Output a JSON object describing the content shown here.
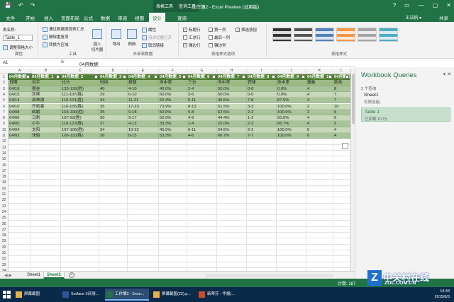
{
  "titlebar": {
    "title": "工作簿2 - Excel Preview (试用版)",
    "context1": "表格工具",
    "context2": "查询工具",
    "quick_access": [
      "💾",
      "↶",
      "↷"
    ],
    "window_controls": [
      "?",
      "▭",
      "—",
      "▢",
      "✕"
    ]
  },
  "tabs": {
    "items": [
      "文件",
      "开始",
      "插入",
      "页面布局",
      "公式",
      "数据",
      "审阅",
      "视图",
      "设计",
      "查询"
    ],
    "active": "设计",
    "user": "王洁帆 ▾",
    "share": "共享"
  },
  "ribbon": {
    "props": {
      "label": "表名称:",
      "table_name": "Table_1",
      "resize": "调整表格大小",
      "group": "属性"
    },
    "tools": {
      "pivot": "通过数据透视表汇总",
      "dedupe": "删除重复项",
      "convert": "转换为区域",
      "slicer": "插入\n切片器",
      "group": "工具"
    },
    "external": {
      "export": "导出",
      "refresh": "刷新",
      "properties": "属性",
      "open_browser": "用浏览器打开",
      "unlink": "取消链接",
      "group": "外部表数据"
    },
    "style_options": {
      "header_row": "标题行",
      "total_row": "汇总行",
      "banded_rows": "镶边行",
      "first_col": "第一列",
      "last_col": "最后一列",
      "banded_cols": "镶边列",
      "filter_btn": "筛选按钮",
      "group": "表格样式选项"
    },
    "styles": {
      "group": "表格样式"
    }
  },
  "formula_bar": {
    "ref": "A1",
    "fx": "fx",
    "value": "04月数据"
  },
  "columns": [
    "A",
    "B",
    "C",
    "D",
    "E",
    "F",
    "G",
    "H",
    "I",
    "J",
    "K",
    "L"
  ],
  "grid": {
    "header_row": [
      "04月数据",
      "04月数据_1",
      "04月数据_2",
      "04月数据_3",
      "04月数据_4",
      "04月数据_5",
      "04月数据_6",
      "04月数据_7",
      "04月数据_8",
      "04月数据_9",
      "04月数据_10",
      "04月数据_"
    ],
    "sub_header": [
      "日期",
      "对手",
      "比分",
      "时间",
      "投篮",
      "命中率",
      "三分",
      "命中率",
      "罚球",
      "命中率",
      "篮板",
      "助攻"
    ],
    "rows": [
      [
        "04/16",
        "掘金",
        "133-126(胜)",
        "40",
        "4-10",
        "40.0%",
        "2-4",
        "50.0%",
        "0-0",
        "0.0%",
        "4",
        "8"
      ],
      [
        "04/15",
        "灰熊",
        "111-107(胜)",
        "29",
        "6-10",
        "60.0%",
        "3-6",
        "50.0%",
        "0-0",
        "0.0%",
        "4",
        "7"
      ],
      [
        "04/14",
        "森林狼",
        "110-101(胜)",
        "34",
        "11-21",
        "52.4%",
        "5-11",
        "45.5%",
        "7-8",
        "87.5%",
        "4",
        "7"
      ],
      [
        "04/10",
        "开拓者",
        "116-105(胜)",
        "35",
        "17-23",
        "73.9%",
        "8-13",
        "61.5%",
        "3-3",
        "100.0%",
        "2",
        "10"
      ],
      [
        "04/08",
        "鹈鹕",
        "103-100(胜)",
        "35",
        "9-18",
        "50.0%",
        "5-8",
        "62.5%",
        "2-2",
        "100.0%",
        "2",
        "9"
      ],
      [
        "04/06",
        "马刺",
        "107-92(胜)",
        "30",
        "9-17",
        "52.9%",
        "4-9",
        "44.4%",
        "1-2",
        "50.0%",
        "4",
        "6"
      ],
      [
        "04/05",
        "小牛",
        "110-123(胜)",
        "27",
        "4-12",
        "33.3%",
        "1-4",
        "25.0%",
        "2-3",
        "66.7%",
        "4",
        "3"
      ],
      [
        "04/04",
        "太阳",
        "107-106(胜)",
        "34",
        "10-22",
        "45.5%",
        "6-11",
        "54.5%",
        "2-2",
        "100.0%",
        "5",
        "4"
      ],
      [
        "04/02",
        "快船",
        "106-110(胜)",
        "36",
        "8-15",
        "53.3%",
        "4-6",
        "66.7%",
        "7-7",
        "100.0%",
        "6",
        "4"
      ]
    ],
    "row_numbers": [
      "1",
      "2",
      "3",
      "4",
      "5",
      "6",
      "7",
      "8",
      "9",
      "10",
      "11",
      "12",
      "13",
      "14",
      "15",
      "16",
      "17",
      "18",
      "19",
      "20",
      "21",
      "22",
      "23",
      "24",
      "25",
      "26",
      "27",
      "28",
      "29",
      "30",
      "31",
      "32",
      "33",
      "34",
      "35"
    ]
  },
  "sheets": {
    "tabs": [
      "Sheet1",
      "Sheet3"
    ],
    "active": "Sheet3",
    "add": "+",
    "nav": "◀ ▶"
  },
  "status": {
    "ready": "",
    "count": "计数: 187"
  },
  "pane": {
    "title": "Workbook Queries",
    "close": "▾ ✕",
    "count": "2 个查询",
    "queries": [
      {
        "name": "Sheet1",
        "status": "仅限连接。"
      },
      {
        "name": "Table 1",
        "status": "已加载 10 行。"
      }
    ]
  },
  "taskbar": {
    "items": [
      {
        "label": "屏幕截图",
        "color": "#e8b04a"
      },
      {
        "label": "Surface 3评测...",
        "color": "#2b5797"
      },
      {
        "label": "工作簿2 - Exce...",
        "color": "#217346"
      },
      {
        "label": "屏幕截图(22).p...",
        "color": "#e8b04a"
      },
      {
        "label": "新蒂芬 - 华报(...",
        "color": "#cc4b2e"
      }
    ],
    "time": "14:44",
    "date": "2015/6/3"
  },
  "watermark": {
    "cn": "中关村在线",
    "en": "ZOL.COM.CN",
    "logo": "Z"
  },
  "colors": {
    "accent": "#217346",
    "header_fill": "#548235",
    "band_dark": "#a9c39a",
    "band_light": "#c6d9b9"
  }
}
